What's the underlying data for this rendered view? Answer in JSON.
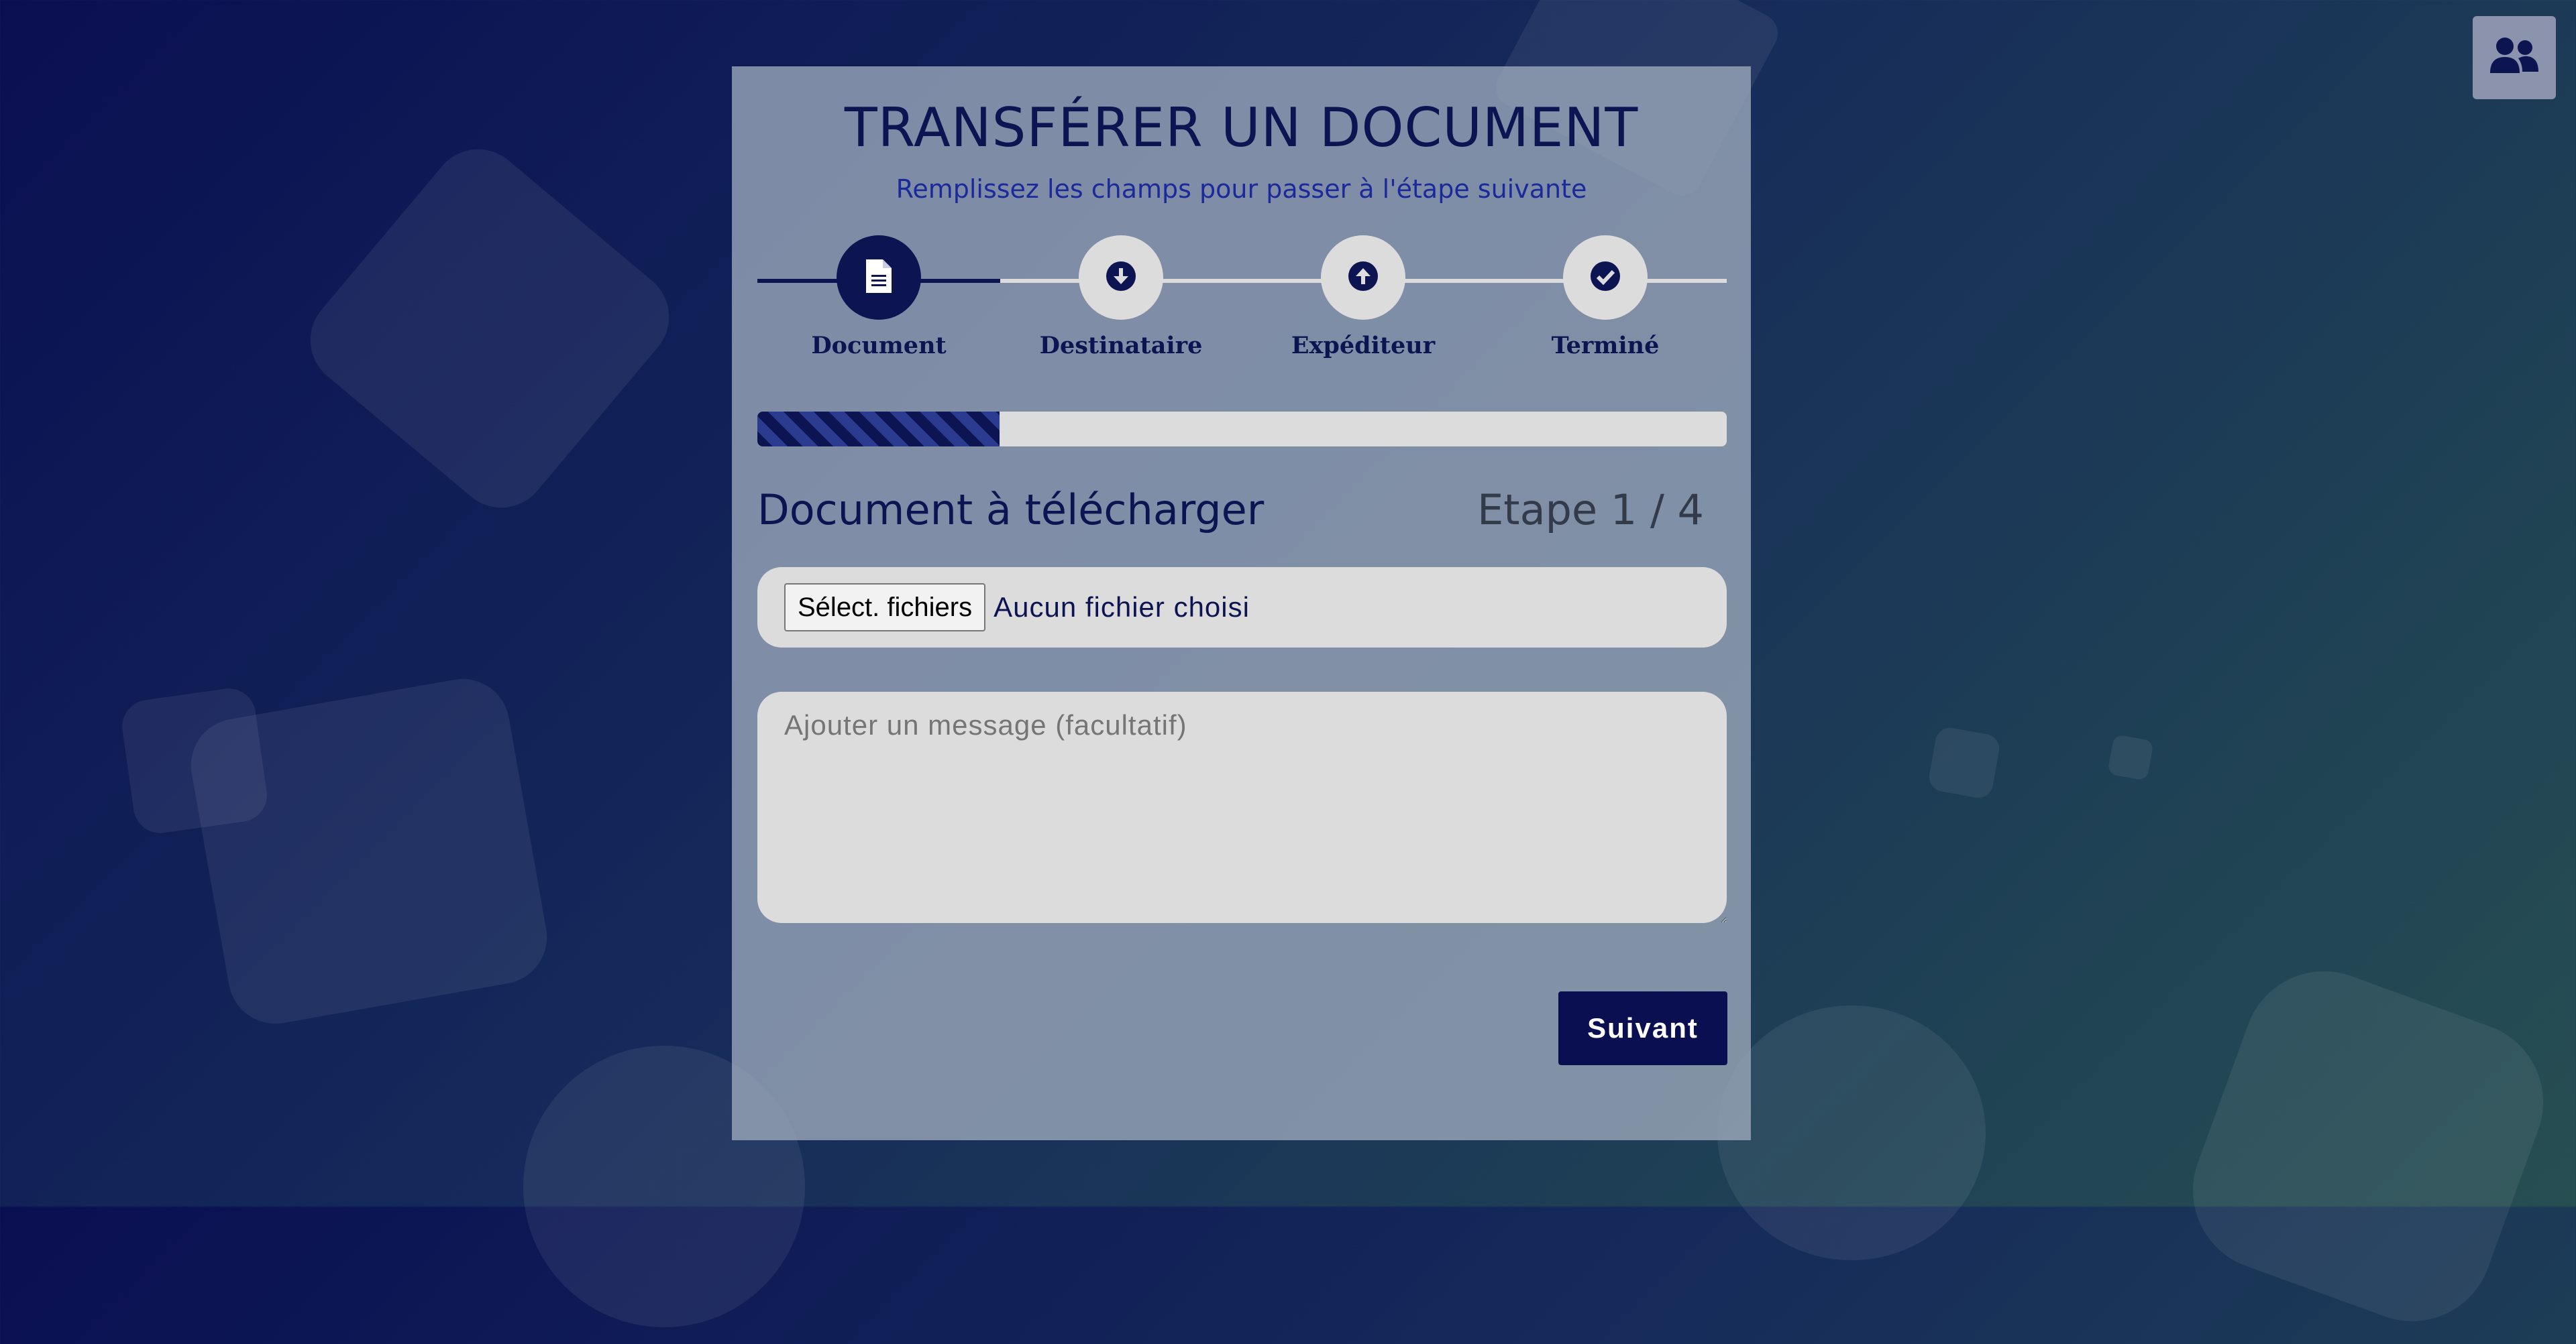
{
  "header": {
    "users_icon": "users-icon"
  },
  "card": {
    "title": "TRANSFÉRER UN DOCUMENT",
    "subtitle": "Remplissez les champs pour passer à l'étape suivante"
  },
  "steps": [
    {
      "label": "Document",
      "icon": "file-icon",
      "active": true
    },
    {
      "label": "Destinataire",
      "icon": "download-icon",
      "active": false
    },
    {
      "label": "Expéditeur",
      "icon": "upload-icon",
      "active": false
    },
    {
      "label": "Terminé",
      "icon": "check-icon",
      "active": false
    }
  ],
  "progress": {
    "fraction": 0.25
  },
  "section": {
    "title": "Document à télécharger",
    "counter": "Etape 1 / 4"
  },
  "file": {
    "button_label": "Sélect. fichiers",
    "status": "Aucun fichier choisi"
  },
  "message": {
    "placeholder": "Ajouter un message (facultatif)",
    "value": ""
  },
  "actions": {
    "next_label": "Suivant"
  },
  "colors": {
    "primary": "#0a0f52",
    "inactive": "#dcdcdc"
  }
}
